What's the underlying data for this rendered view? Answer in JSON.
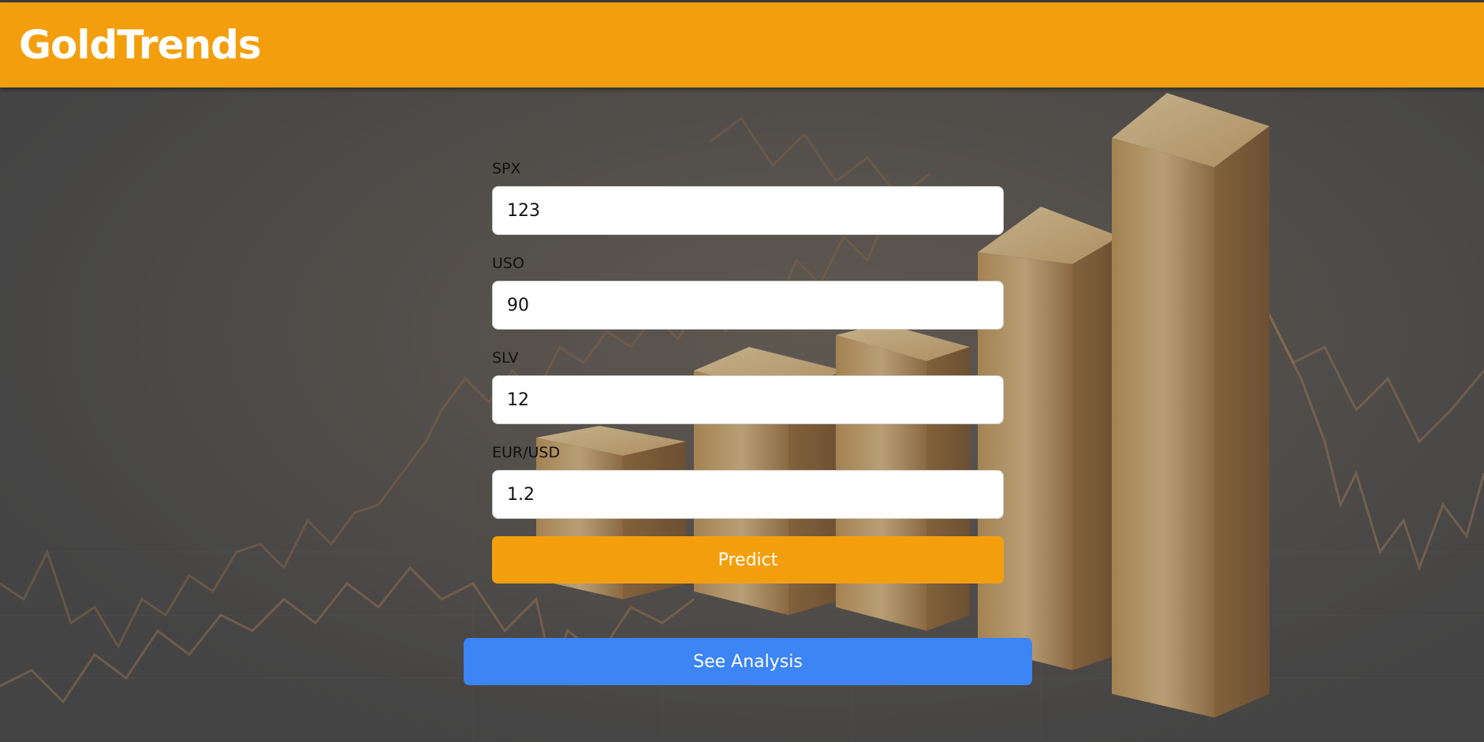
{
  "header": {
    "brand": "GoldTrends"
  },
  "form": {
    "fields": [
      {
        "label": "SPX",
        "value": "123"
      },
      {
        "label": "USO",
        "value": "90"
      },
      {
        "label": "SLV",
        "value": "12"
      },
      {
        "label": "EUR/USD",
        "value": "1.2"
      }
    ],
    "predict_label": "Predict"
  },
  "analysis_label": "See Analysis",
  "colors": {
    "header": "#f39f0d",
    "predict_button": "#f39f0d",
    "analysis_button": "#3d84f5",
    "background": "#4a4a4a"
  }
}
